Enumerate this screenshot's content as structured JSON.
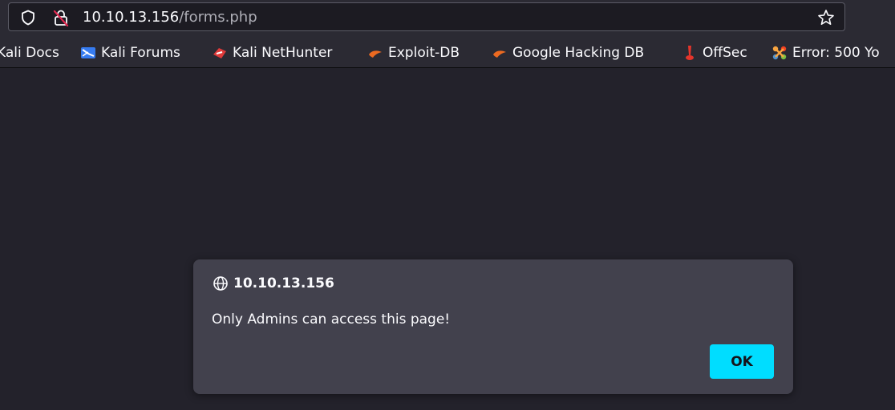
{
  "browser": {
    "url_host": "10.10.13.156",
    "url_path": "/forms.php",
    "icons": {
      "tracking_protection": "shield-icon",
      "insecure_connection": "lock-broken-icon",
      "bookmark": "star-icon"
    }
  },
  "bookmarks": [
    {
      "label": "Kali Docs",
      "icon": "kali-docs-icon"
    },
    {
      "label": "Kali Forums",
      "icon": "kali-dragon-icon"
    },
    {
      "label": "Kali NetHunter",
      "icon": "nethunter-icon"
    },
    {
      "label": "Exploit-DB",
      "icon": "exploit-db-icon"
    },
    {
      "label": "Google Hacking DB",
      "icon": "ghdb-icon"
    },
    {
      "label": "OffSec",
      "icon": "offsec-icon"
    },
    {
      "label": "Error: 500 Yo",
      "icon": "joomla-icon"
    }
  ],
  "dialog": {
    "origin": "10.10.13.156",
    "message": "Only Admins can access this page!",
    "ok_label": "OK"
  },
  "colors": {
    "page_background": "#23222b",
    "toolbar": "#2b2a33",
    "dialog_background": "#42414d",
    "ok_button": "#00ddff"
  }
}
